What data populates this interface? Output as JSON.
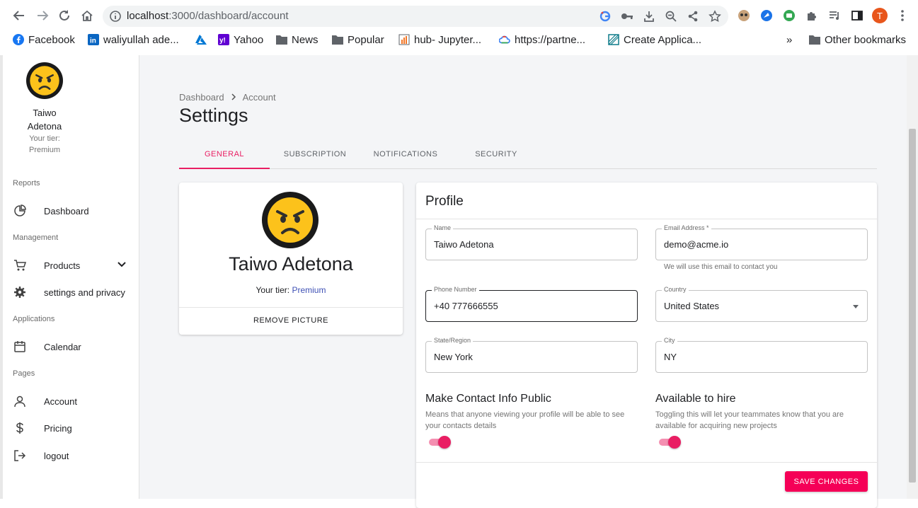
{
  "browser": {
    "url_host": "localhost",
    "url_path": ":3000/dashboard/account",
    "profile_initial": "T",
    "bookmarks": [
      {
        "label": "Facebook",
        "icon": "facebook-icon"
      },
      {
        "label": "waliyullah ade...",
        "icon": "linkedin-icon"
      },
      {
        "label": "",
        "icon": "azure-icon"
      },
      {
        "label": "Yahoo",
        "icon": "yahoo-icon"
      },
      {
        "label": "News",
        "icon": "folder-icon"
      },
      {
        "label": "Popular",
        "icon": "folder-icon"
      },
      {
        "label": "hub- Jupyter...",
        "icon": "jupyter-icon"
      },
      {
        "label": "https://partne...",
        "icon": "google-cloud-icon"
      },
      {
        "label": "Create Applica...",
        "icon": "app-icon"
      }
    ],
    "more_bookmarks": "»",
    "other_bookmarks": "Other bookmarks"
  },
  "sidebar": {
    "user_first": "Taiwo",
    "user_last": "Adetona",
    "tier_label": "Your tier:",
    "tier_value": "Premium",
    "sections": {
      "reports": "Reports",
      "management": "Management",
      "applications": "Applications",
      "pages": "Pages"
    },
    "items": {
      "dashboard": "Dashboard",
      "products": "Products",
      "settings": "settings and privacy",
      "calendar": "Calendar",
      "account": "Account",
      "pricing": "Pricing",
      "logout": "logout"
    }
  },
  "main": {
    "breadcrumb": [
      "Dashboard",
      "Account"
    ],
    "title": "Settings",
    "tabs": [
      "GENERAL",
      "SUBSCRIPTION",
      "NOTIFICATIONS",
      "SECURITY"
    ],
    "active_tab": "GENERAL",
    "profile_card": {
      "name": "Taiwo Adetona",
      "tier_label": "Your tier:",
      "tier_value": "Premium",
      "remove_label": "REMOVE PICTURE"
    },
    "profile_form": {
      "title": "Profile",
      "name_label": "Name",
      "name_value": "Taiwo Adetona",
      "email_label": "Email Address *",
      "email_value": "demo@acme.io",
      "email_helper": "We will use this email to contact you",
      "phone_label": "Phone Number",
      "phone_value": "+40 777666555",
      "country_label": "Country",
      "country_value": "United States",
      "state_label": "State/Region",
      "state_value": "New York",
      "city_label": "City",
      "city_value": "NY",
      "contact_public_title": "Make Contact Info Public",
      "contact_public_desc": "Means that anyone viewing your profile will be able to see your contacts details",
      "contact_public_on": true,
      "hire_title": "Available to hire",
      "hire_desc": "Toggling this will let your teammates know that you are available for acquiring new projects",
      "hire_on": true,
      "save_label": "SAVE CHANGES"
    }
  },
  "colors": {
    "accent": "#e91e63",
    "primary": "#3f51b5",
    "save_button": "#f50057"
  }
}
